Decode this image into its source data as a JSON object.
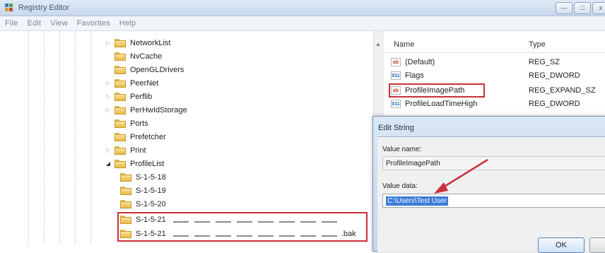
{
  "window": {
    "title": "Registry Editor",
    "buttons": {
      "minimize": "—",
      "maximize": "□",
      "close": "x"
    }
  },
  "menu": [
    "File",
    "Edit",
    "View",
    "Favorites",
    "Help"
  ],
  "tree": {
    "items": [
      {
        "label": "NetworkList",
        "expander": "▷"
      },
      {
        "label": "NvCache",
        "expander": ""
      },
      {
        "label": "OpenGLDrivers",
        "expander": ""
      },
      {
        "label": "PeerNet",
        "expander": "▷"
      },
      {
        "label": "Perflib",
        "expander": "▷"
      },
      {
        "label": "PerHwIdStorage",
        "expander": "▷"
      },
      {
        "label": "Ports",
        "expander": ""
      },
      {
        "label": "Prefetcher",
        "expander": ""
      },
      {
        "label": "Print",
        "expander": "▷"
      },
      {
        "label": "ProfileList",
        "expander": "◢"
      },
      {
        "label": "S-1-5-18",
        "expander": ""
      },
      {
        "label": "S-1-5-19",
        "expander": ""
      },
      {
        "label": "S-1-5-20",
        "expander": ""
      },
      {
        "label": "S-1-5-21",
        "expander": ""
      },
      {
        "label": "S-1-5-21",
        "expander": ""
      }
    ],
    "bak_suffix": ".bak"
  },
  "values": {
    "headers": {
      "name": "Name",
      "type": "Type"
    },
    "rows": [
      {
        "name": "(Default)",
        "type": "REG_SZ",
        "icon": "ab"
      },
      {
        "name": "Flags",
        "type": "REG_DWORD",
        "icon": "011"
      },
      {
        "name": "ProfileImagePath",
        "type": "REG_EXPAND_SZ",
        "icon": "ab"
      },
      {
        "name": "ProfileLoadTimeHigh",
        "type": "REG_DWORD",
        "icon": "011"
      }
    ]
  },
  "dialog": {
    "title": "Edit String",
    "value_name_label": "Value name:",
    "value_name": "ProfileImagePath",
    "value_data_label": "Value data:",
    "value_data": "C:\\Users\\Test User",
    "ok_label": "OK"
  },
  "colors": {
    "highlight": "#c9303a",
    "selection": "#3b7ad9",
    "arrow": "#c9303a"
  }
}
